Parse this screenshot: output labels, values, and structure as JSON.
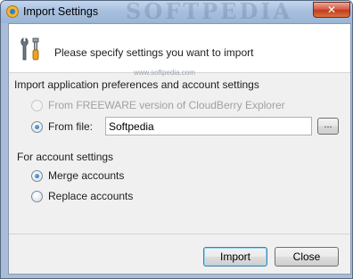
{
  "window": {
    "title": "Import Settings",
    "close_label": "✕",
    "watermark": "SOFTPEDIA"
  },
  "header": {
    "text": "Please specify settings you want to import",
    "watermark_note": "www.softpedia.com"
  },
  "import_section": {
    "label": "Import application preferences and account settings",
    "options": [
      {
        "label": "From FREEWARE version of CloudBerry Explorer",
        "checked": false,
        "disabled": true
      },
      {
        "label": "From file:",
        "checked": true,
        "disabled": false
      }
    ],
    "file_value": "Softpedia",
    "browse_label": "..."
  },
  "account_section": {
    "label": "For account settings",
    "options": [
      {
        "label": "Merge accounts",
        "checked": true
      },
      {
        "label": "Replace accounts",
        "checked": false
      }
    ]
  },
  "buttons": {
    "import_label": "Import",
    "close_label": "Close"
  },
  "colors": {
    "accent": "#1b65b5",
    "titlebar": "#a8c0de",
    "close_button": "#c13a20"
  }
}
